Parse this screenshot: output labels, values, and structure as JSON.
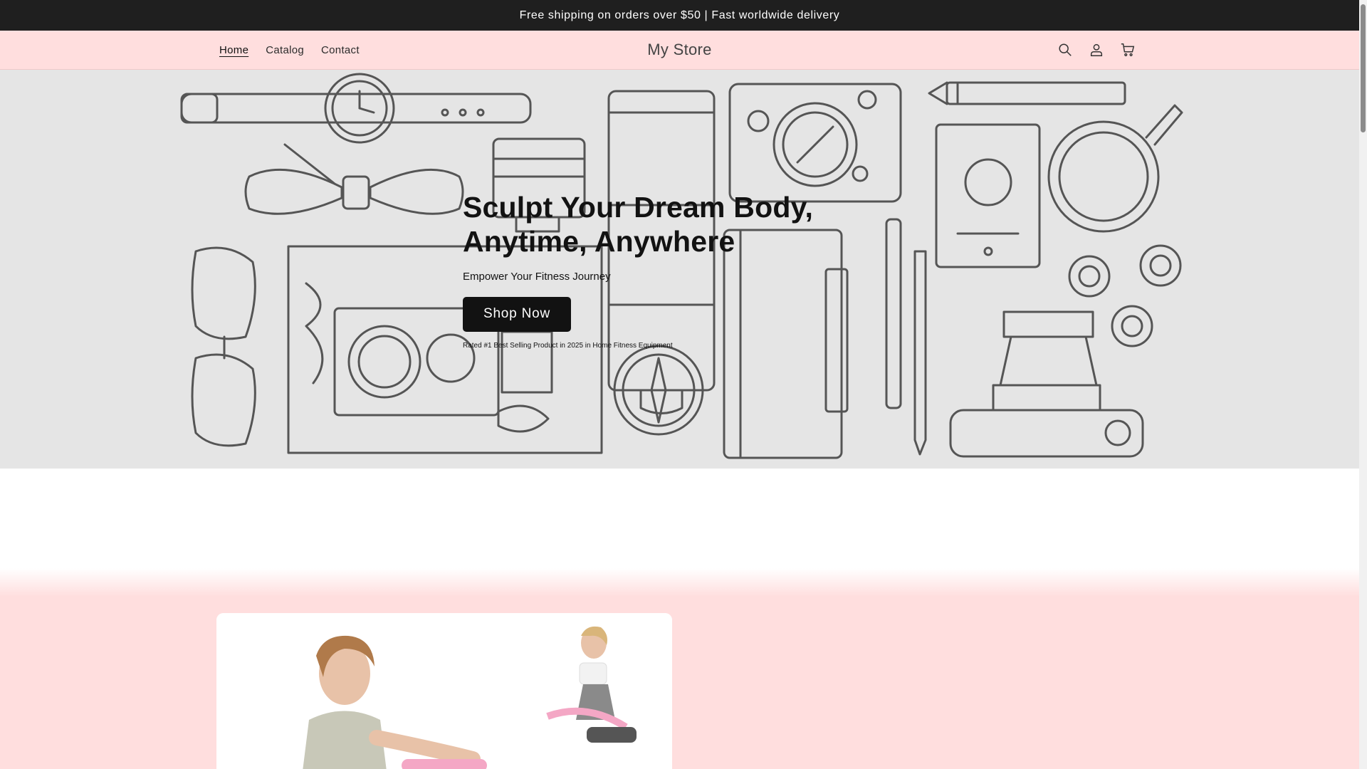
{
  "announcement": {
    "text": "Free shipping on orders over $50 | Fast worldwide delivery"
  },
  "header": {
    "nav": [
      "Home",
      "Catalog",
      "Contact"
    ],
    "active_nav": "Home",
    "brand": "My Store",
    "icons": [
      "search-icon",
      "account-icon",
      "cart-icon"
    ]
  },
  "hero": {
    "title_line1": "Sculpt Your Dream Body,",
    "title_line2": "Anytime, Anywhere",
    "subtitle": "Empower Your Fitness Journey",
    "button_label": "Shop Now",
    "rated_text": "Rated #1 Best Selling Product in 2025 in Home Fitness Equipment"
  },
  "colors": {
    "announcement_bg": "#1f1f1f",
    "header_bg": "#ffdede",
    "hero_bg": "#e5e5e5",
    "button_bg": "#121212",
    "section_bg": "#ffdede"
  }
}
